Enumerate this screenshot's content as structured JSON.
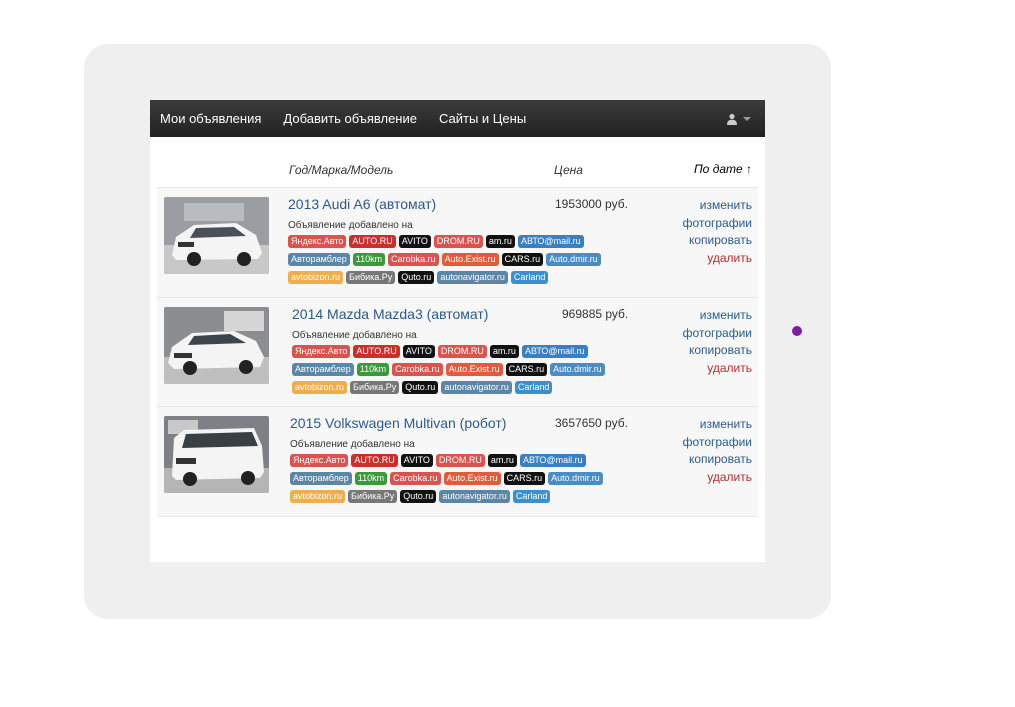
{
  "nav": {
    "items": [
      "Мои объявления",
      "Добавить объявление",
      "Сайты и Цены"
    ],
    "user_icon": "user-icon"
  },
  "table_header": {
    "model": "Год/Марка/Модель",
    "price": "Цена",
    "sort": "По дате ↑"
  },
  "listings": [
    {
      "title": "2013 Audi A6 (автомат)",
      "price": "1953000 руб.",
      "added": "Объявление добавлено на",
      "car_color": "#f4f4f4"
    },
    {
      "title": "2014 Mazda Mazda3 (автомат)",
      "price": "969885 руб.",
      "added": "Объявление добавлено на",
      "car_color": "#f4f4f4"
    },
    {
      "title": "2015 Volkswagen Multivan (робот)",
      "price": "3657650 руб.",
      "added": "Объявление добавлено на",
      "car_color": "#f4f4f4"
    }
  ],
  "sites": [
    {
      "name": "Яндекс.Авто",
      "color": "#d9534f"
    },
    {
      "name": "AUTO.RU",
      "color": "#c9302c"
    },
    {
      "name": "AVITO",
      "color": "#111111"
    },
    {
      "name": "DROM.RU",
      "color": "#d9534f"
    },
    {
      "name": "am.ru",
      "color": "#111111"
    },
    {
      "name": "АВТО@mail.ru",
      "color": "#3a7fc1"
    },
    {
      "name": "Авторамблер",
      "color": "#5b86a6"
    },
    {
      "name": "110km",
      "color": "#3a9a3a"
    },
    {
      "name": "Carobka.ru",
      "color": "#d9534f"
    },
    {
      "name": "Auto.Exist.ru",
      "color": "#e25b3a"
    },
    {
      "name": "CARS.ru",
      "color": "#111111"
    },
    {
      "name": "Auto.dmir.ru",
      "color": "#4a8cc4"
    },
    {
      "name": "avtobizon.ru",
      "color": "#f0ad4e"
    },
    {
      "name": "Бибика.Ру",
      "color": "#777777"
    },
    {
      "name": "Quto.ru",
      "color": "#111111"
    },
    {
      "name": "autonavigator.ru",
      "color": "#5b86a6"
    },
    {
      "name": "Carland",
      "color": "#3a8fd1"
    }
  ],
  "actions": {
    "edit": "изменить",
    "photos": "фотографии",
    "copy": "копировать",
    "delete": "удалить"
  },
  "colors": {
    "link": "#2a5a8c",
    "delete": "#b03030",
    "indicator_dot": "#7b1fa2"
  }
}
